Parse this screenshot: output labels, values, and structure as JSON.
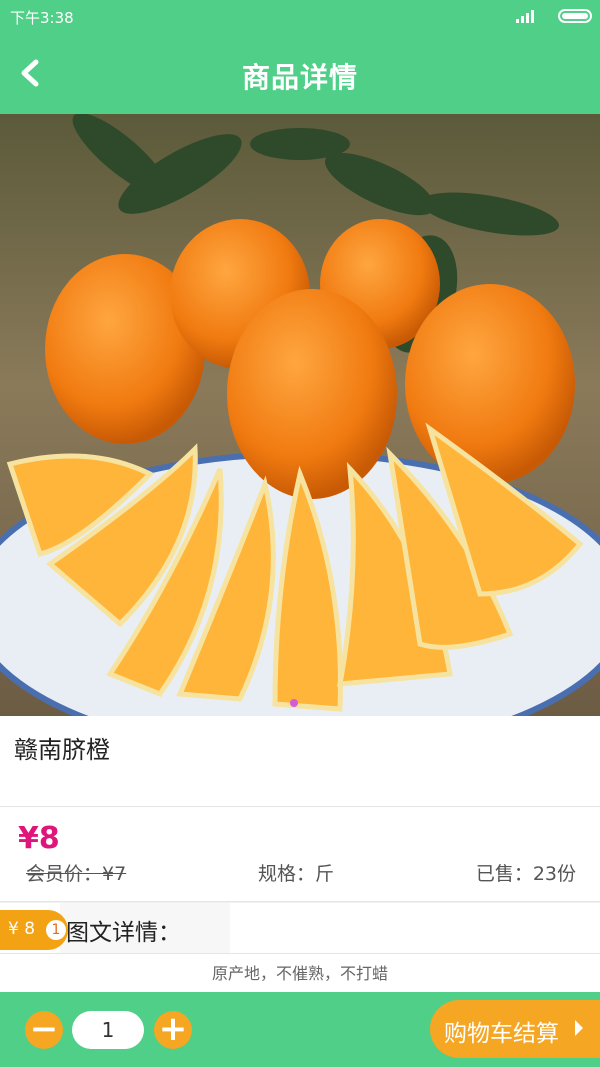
{
  "status": {
    "time": "下午3:38"
  },
  "header": {
    "title": "商品详情"
  },
  "product": {
    "name": "赣南脐橙",
    "price": "¥8",
    "member_price": "会员价：¥7",
    "spec": "规格：斤",
    "sold": "已售：23份",
    "detail_label": "图文详情：",
    "description": "原产地，不催熟，不打蜡"
  },
  "cart_float": {
    "amount": "¥ 8",
    "count": "1"
  },
  "bottom": {
    "minus": "−",
    "quantity": "1",
    "plus": "+",
    "checkout": "购物车结算"
  },
  "colors": {
    "primary": "#4fcf87",
    "accent": "#f5a623",
    "price": "#e0157b"
  }
}
